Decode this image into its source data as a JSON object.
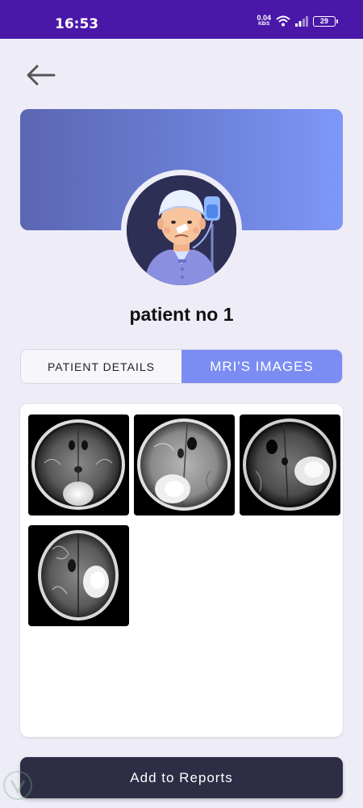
{
  "status_bar": {
    "time": "16:53",
    "net_speed_value": "0.04",
    "net_speed_unit": "KB/S",
    "battery": "29",
    "icons": [
      "wifi-icon",
      "signal-icon",
      "battery-icon"
    ]
  },
  "header": {
    "back_icon": "arrow-left-icon"
  },
  "patient": {
    "name": "patient no 1",
    "avatar_icon": "patient-avatar-icon"
  },
  "tabs": [
    {
      "label": "PATIENT DETAILS",
      "active": false
    },
    {
      "label": "MRI'S IMAGES",
      "active": true
    }
  ],
  "gallery": {
    "images": [
      {
        "label": "mri-image-1"
      },
      {
        "label": "mri-image-2"
      },
      {
        "label": "mri-image-3"
      },
      {
        "label": "mri-image-4"
      }
    ]
  },
  "actions": {
    "add_to_reports": "Add to Reports"
  },
  "colors": {
    "status_bar": "#4a17a8",
    "background": "#eeedf7",
    "banner_start": "#5b66b2",
    "banner_end": "#7f97f8",
    "tab_active": "#7b8cf2",
    "button": "#2d2d45"
  }
}
